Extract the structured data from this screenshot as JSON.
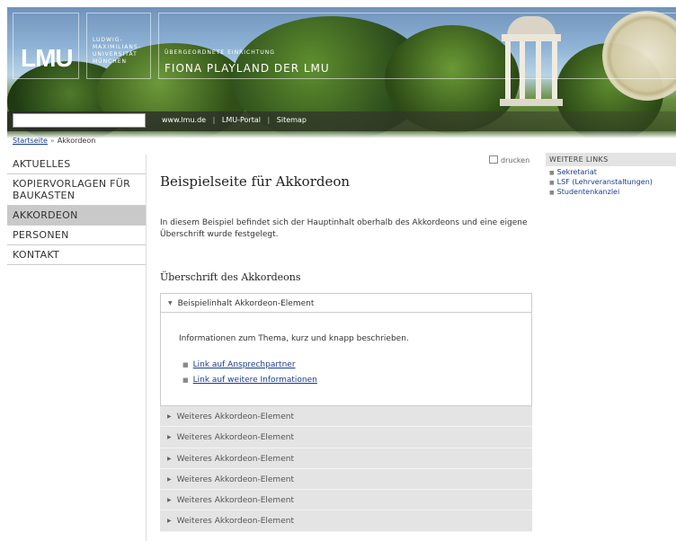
{
  "header": {
    "logo_lmu": "LMU",
    "university_lines": [
      "LUDWIG-",
      "MAXIMILIANS-",
      "UNIVERSITÄT",
      "MÜNCHEN"
    ],
    "overline": "ÜBERGEORDNETE EINRICHTUNG",
    "site_title": "FIONA PLAYLAND DER LMU",
    "search": {
      "value": "",
      "placeholder": ""
    },
    "top_links": [
      "www.lmu.de",
      "LMU-Portal",
      "Sitemap"
    ]
  },
  "breadcrumb": {
    "home": "Startseite",
    "separator": "»",
    "current": "Akkordeon"
  },
  "sidebar": {
    "items": [
      {
        "label": "AKTUELLES",
        "active": false
      },
      {
        "label": "KOPIERVORLAGEN FÜR BAUKASTEN",
        "active": false
      },
      {
        "label": "AKKORDEON",
        "active": true
      },
      {
        "label": "PERSONEN",
        "active": false
      },
      {
        "label": "KONTAKT",
        "active": false
      }
    ]
  },
  "main": {
    "print_label": "drucken",
    "title": "Beispielseite für Akkordeon",
    "intro": "In diesem Beispiel befindet sich der Hauptinhalt oberhalb des Akkordeons und eine eigene Überschrift wurde festgelegt.",
    "accordion_heading": "Überschrift des Akkordeons",
    "accordion": {
      "open_item": {
        "label": "Beispielinhalt Akkordeon-Element",
        "info": "Informationen zum Thema, kurz und knapp beschrieben.",
        "links": [
          "Link auf Ansprechpartner",
          "Link auf weitere Informationen"
        ]
      },
      "closed_items": [
        "Weiteres Akkordeon-Element",
        "Weiteres Akkordeon-Element",
        "Weiteres Akkordeon-Element",
        "Weiteres Akkordeon-Element",
        "Weiteres Akkordeon-Element",
        "Weiteres Akkordeon-Element"
      ]
    }
  },
  "right": {
    "heading": "WEITERE LINKS",
    "links": [
      "Sekretariat",
      "LSF (Lehrveranstaltungen)",
      "Studentenkanzlei"
    ]
  },
  "colors": {
    "link": "#1a3c8e",
    "active_nav": "#c9c9c9",
    "accordion_row": "#e4e4e4"
  }
}
